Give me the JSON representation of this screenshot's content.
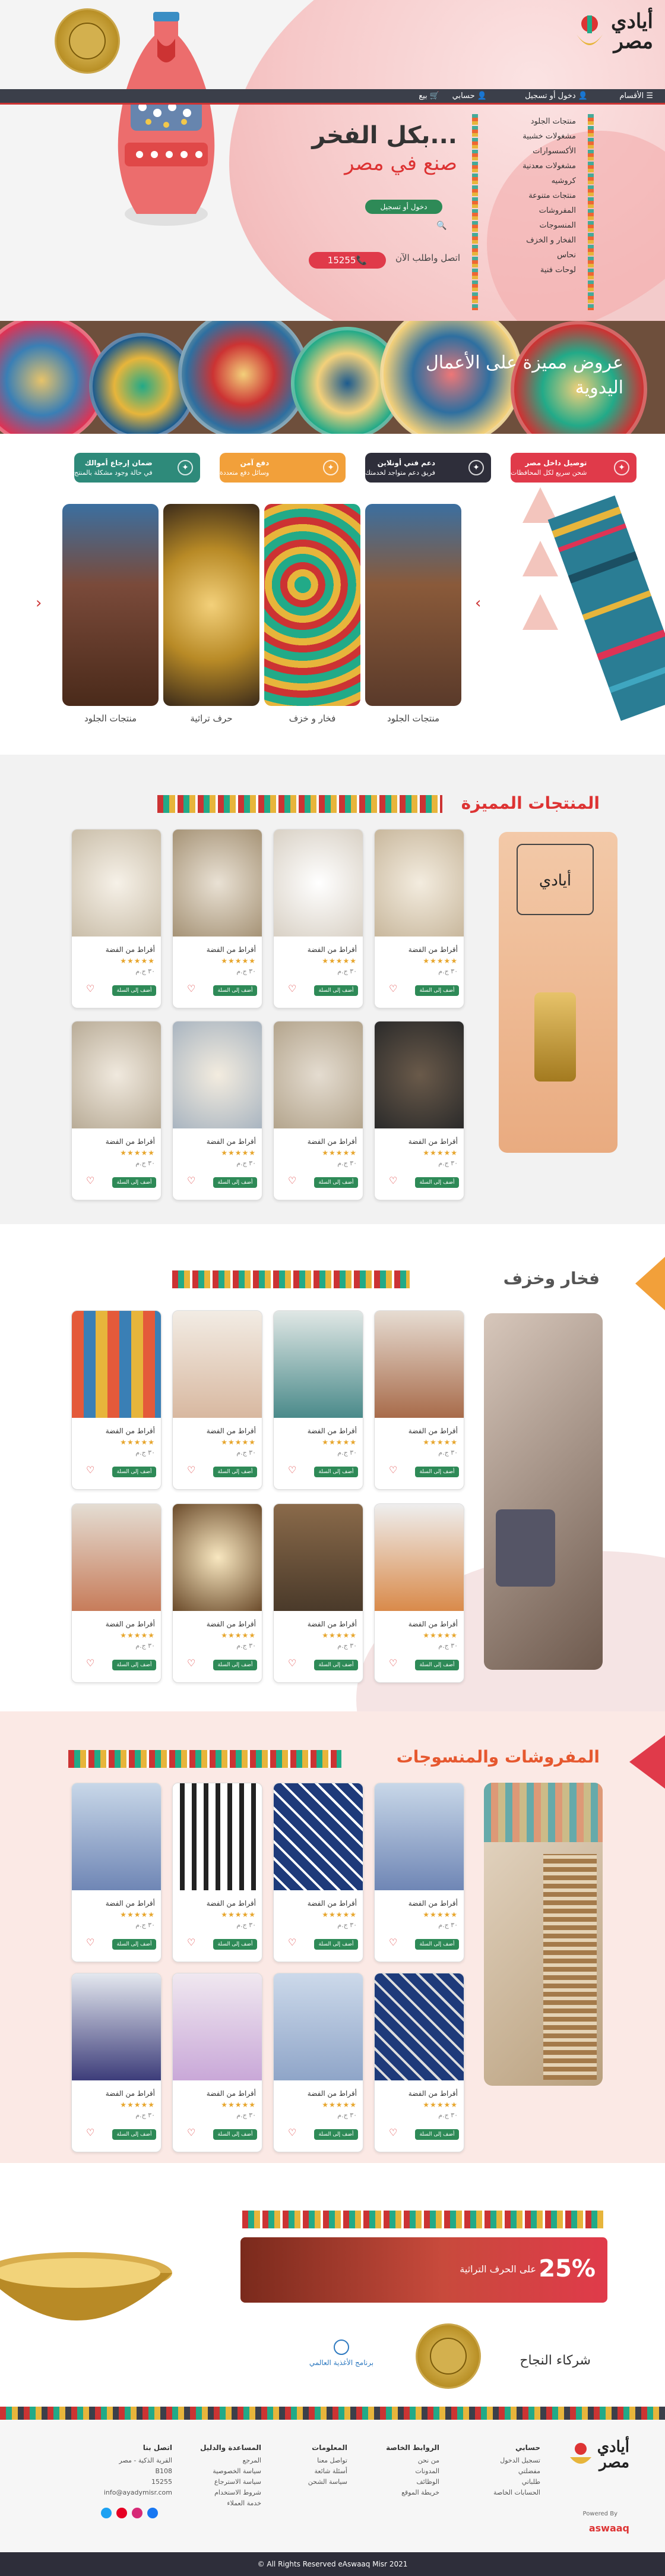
{
  "site": {
    "logo_line1": "أيادي",
    "logo_line2": "مصر"
  },
  "topbar": {
    "categories": "الأقسام",
    "login": "دخول أو تسجيل",
    "account": "حسابي",
    "cart": "بيع"
  },
  "menu": [
    "منتجات الجلود",
    "مشغولات خشبية",
    "الأكسسوارات",
    "مشغولات معدنية",
    "كروشيه",
    "منتجات متنوعة",
    "المفروشات",
    "المنسوجات",
    "الفخار و الخزف",
    "نحاس",
    "لوحات فنية"
  ],
  "hero": {
    "title": "...بكل الفخر",
    "subtitle": "صنع في مصر",
    "login_btn": "دخول أو تسجيل",
    "call_text": "اتصل واطلب الآن",
    "phone": "15255"
  },
  "banner": {
    "caption_line1": "عروض مميزة على الأعمال",
    "caption_line2": "اليدوية"
  },
  "features": [
    {
      "title": "توصيل داخل مصر",
      "text": "شحن سريع لكل المحافظات",
      "color": "#e03a4a",
      "icon": "truck-icon"
    },
    {
      "title": "دعم فني أونلاين",
      "text": "فريق دعم متواجد لخدمتك",
      "color": "#2e2e3a",
      "icon": "support-icon"
    },
    {
      "title": "دفع آمن",
      "text": "وسائل دفع متعددة",
      "color": "#f2a03a",
      "icon": "card-icon"
    },
    {
      "title": "ضمان إرجاع أموالك",
      "text": "في حالة وجود مشكلة بالمنتج",
      "color": "#2e8a7a",
      "icon": "money-icon"
    }
  ],
  "categories": [
    "منتجات الجلود",
    "فخار و خزف",
    "حرف تراثية",
    "منتجات الجلود"
  ],
  "sections": {
    "featured": "المنتجات المميزة",
    "pottery": "فخار وخزف",
    "textiles": "المفروشات والمنسوجات"
  },
  "product": {
    "title": "أقراط من الفضة",
    "stars": "★★★★★",
    "price": "٣٠ ج.م",
    "button": "أضف إلى السلة"
  },
  "promo": {
    "percent": "25%",
    "text": "على الحرف التراثية"
  },
  "partners": {
    "title": "شركاء النجاح",
    "wfp": "برنامج الأغذية العالمي"
  },
  "footer": {
    "col1_title": "حسابي",
    "col1": [
      "تسجيل الدخول",
      "مفضلتي",
      "طلباتي",
      "الحسابات الخاصة"
    ],
    "col2_title": "الروابط الخاصة",
    "col2": [
      "من نحن",
      "المدونات",
      "الوظائف",
      "خريطة الموقع"
    ],
    "col3_title": "المعلومات",
    "col3": [
      "تواصل معنا",
      "أسئلة شائعة",
      "سياسة الشحن"
    ],
    "col4_title": "المساعدة والدليل",
    "col4": [
      "المرجع",
      "سياسة الخصوصية",
      "سياسة الاسترجاع",
      "شروط الاستخدام",
      "خدمة العملاء"
    ],
    "col5_title": "اتصل بنا",
    "col5": [
      "القرية الذكية - مصر",
      "B108",
      "15255",
      "info@ayadymisr.com"
    ],
    "powered": "Powered By",
    "brand": "aswaaq"
  },
  "copyright": "All Rights Reserved eAswaaq Misr 2021 ©"
}
